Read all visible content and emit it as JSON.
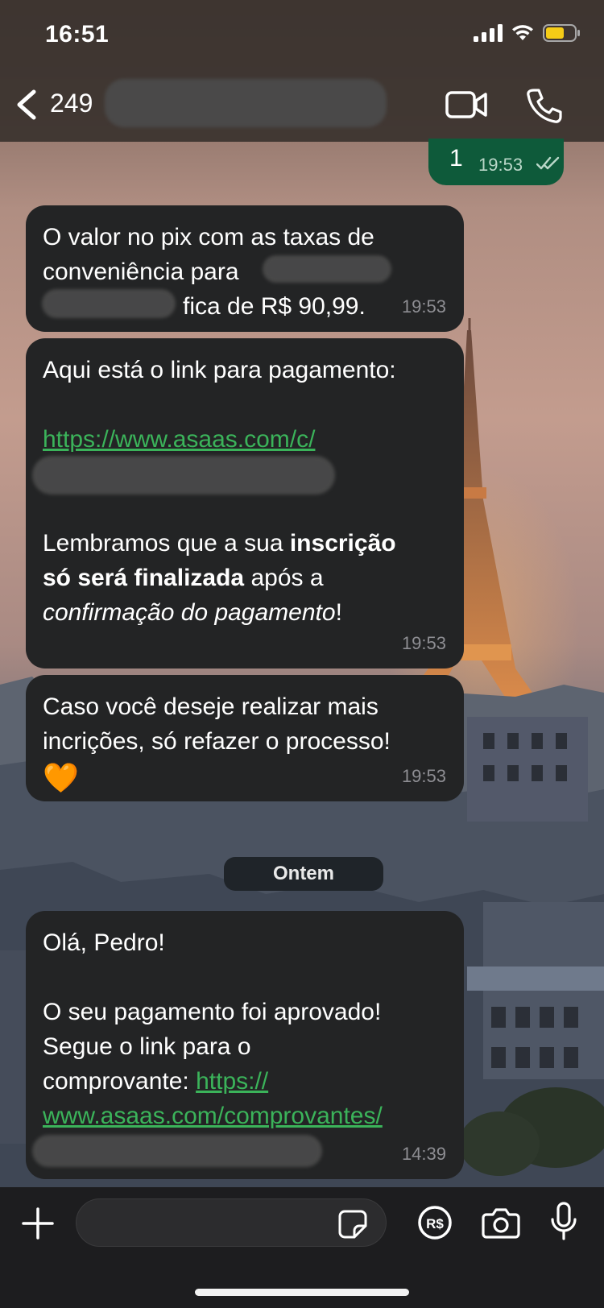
{
  "status_bar": {
    "time": "16:51"
  },
  "header": {
    "title": "249"
  },
  "messages": {
    "outgoing": {
      "text": "1",
      "time": "19:53"
    },
    "m1": {
      "line1": "O valor no pix com as taxas de",
      "line2": "conveniência para",
      "line3": "fica de R$ 90,99.",
      "time": "19:53"
    },
    "m2": {
      "intro": "Aqui está o link para pagamento:",
      "link": "https://www.asaas.com/c/",
      "p1": "Lembramos que a sua ",
      "b1": "inscrição",
      "b2": "só será finalizada",
      "p2": " após a",
      "i1": "confirmação do pagamento",
      "p3": "!",
      "time": "19:53"
    },
    "m3": {
      "line1": "Caso você deseje realizar mais",
      "line2": "incrições, só refazer o processo!",
      "emoji": "🧡",
      "time": "19:53"
    },
    "date_chip": "Ontem",
    "m4": {
      "greeting": "Olá, Pedro!",
      "line1": "O seu pagamento foi aprovado!",
      "line2": "Segue o link para o",
      "line3": "comprovante: ",
      "link1": "https://",
      "link2": "www.asaas.com/comprovantes/",
      "time": "14:39"
    }
  },
  "composer": {
    "placeholder": ""
  },
  "colors": {
    "link": "#3bb35a",
    "outgoing_bubble": "#0e5a3a",
    "incoming_bubble": "#232425"
  },
  "icons": [
    "back-chevron-icon",
    "video-call-icon",
    "phone-icon",
    "plus-icon",
    "sticker-icon",
    "payment-icon",
    "camera-icon",
    "microphone-icon",
    "read-ticks-icon"
  ]
}
